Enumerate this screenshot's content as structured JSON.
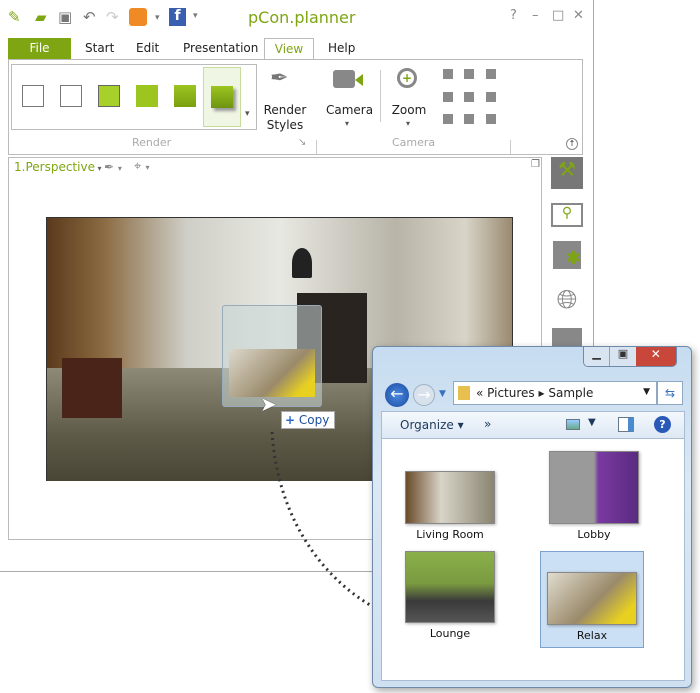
{
  "app": {
    "title": "pCon.planner",
    "window_controls": [
      "?",
      "–",
      "□",
      "✕"
    ],
    "quick_access": [
      "app-logo-icon",
      "open-icon",
      "save-icon",
      "undo-icon",
      "redo-icon",
      "rss-icon",
      "facebook-icon"
    ],
    "tabs": [
      "File",
      "Start",
      "Edit",
      "Presentation",
      "View",
      "Help"
    ],
    "active_tab": "View",
    "ribbon": {
      "render_group": "Render",
      "camera_group": "Camera",
      "render_styles": "Render Styles",
      "camera": "Camera",
      "zoom": "Zoom"
    },
    "viewport": {
      "view_name": "1.Perspective"
    },
    "drag": {
      "copy_label": "Copy"
    },
    "accent": "#7ea512"
  },
  "explorer": {
    "path": [
      "Pictures",
      "Sample"
    ],
    "organize": "Organize",
    "more": "»",
    "files": [
      {
        "name": "Living Room"
      },
      {
        "name": "Lobby"
      },
      {
        "name": "Lounge"
      },
      {
        "name": "Relax",
        "selected": true
      }
    ]
  }
}
